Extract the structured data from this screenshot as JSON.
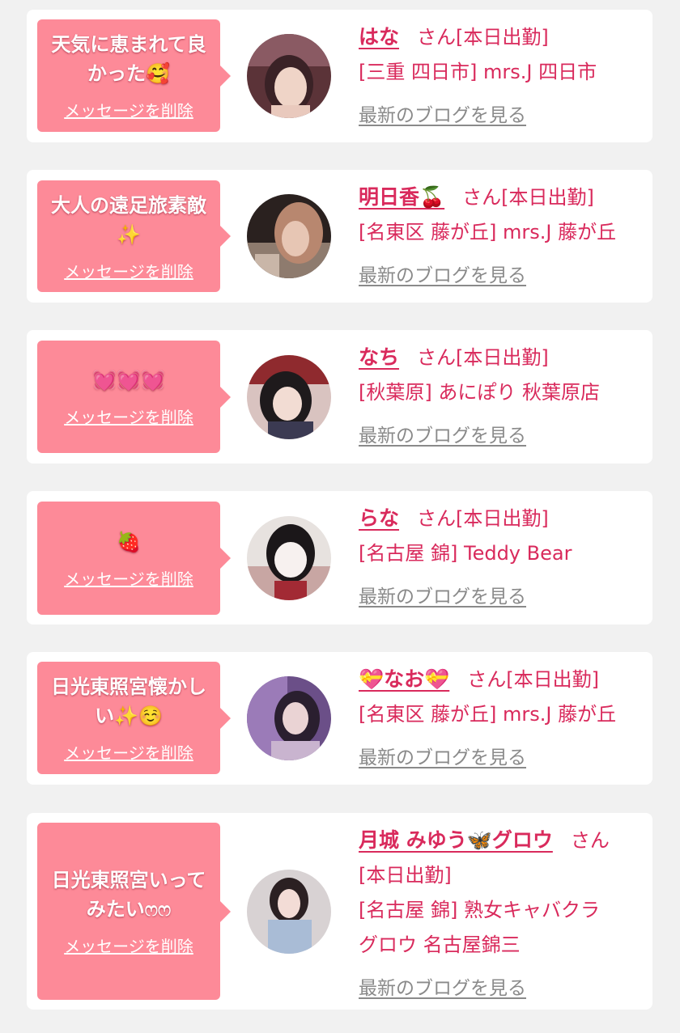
{
  "delete_label": "メッセージを削除",
  "blog_label": "最新のブログを見る",
  "san_label": "さん",
  "status_label": "[本日出勤]",
  "cards": [
    {
      "message": "天気に恵まれて良かった🥰",
      "name": "はな",
      "store": "[三重 四日市] mrs.J 四日市"
    },
    {
      "message": "大人の遠足旅素敵✨",
      "name": "明日香🍒",
      "store": "[名東区 藤が丘] mrs.J 藤が丘"
    },
    {
      "message": "💓💓💓",
      "name": "なち",
      "store": "[秋葉原] あにぽり 秋葉原店"
    },
    {
      "message": "🍓",
      "name": "らな",
      "store": "[名古屋 錦] Teddy Bear"
    },
    {
      "message": "日光東照宮懐かしい✨☺️",
      "name": "💝なお💝",
      "store": "[名東区 藤が丘] mrs.J 藤が丘"
    },
    {
      "message": "日光東照宮いってみたいෆෆ",
      "name": "月城 みゆう🦋グロウ",
      "store_line1": "[名古屋 錦] 熟女キャバクラ",
      "store_line2": "グロウ 名古屋錦三"
    }
  ]
}
